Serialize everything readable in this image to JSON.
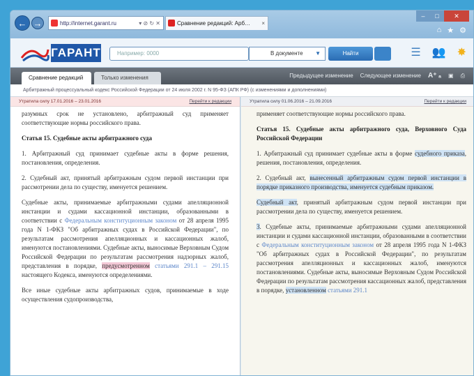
{
  "browser": {
    "address": "http://internet.garant.ru",
    "addr_controls": "▾ ⊘ ↻ ✕",
    "tab_title": "Сравнение редакций: Арб…",
    "tab_close": "×"
  },
  "app": {
    "logo_text": "ГАРАНТ",
    "search_placeholder": "Например: 0000",
    "scope_value": "В документе",
    "find_button": "Найти"
  },
  "doc_tabs": [
    "Сравнение редакций",
    "Только изменения"
  ],
  "toolbar": {
    "prev_change": "Предыдущее изменение",
    "next_change": "Следующее изменение",
    "font_size": "A⁺ ₐ"
  },
  "doc_title_line": "Арбитражный процессуальный кодекс Российской Федерации от 24 июля 2002 г. N 95-ФЗ (АПК РФ) (с изменениями и дополнениями)",
  "left": {
    "edition": "Утратила силу 17.01.2016 – 23.01.2016",
    "link": "Перейти к редакции",
    "intro": "разумных срок не установлено, арбитражный суд применяет соответствующие нормы российского права.",
    "heading": "Статья 15. Судебные акты арбитражного суда",
    "p1": "1. Арбитражный суд принимает судебные акты в форме решения, постановления, определения.",
    "p2": "2. Судебный акт, принятый арбитражным судом первой инстанции при рассмотрении дела по существу, именуется решением.",
    "p3_a": "Судебные акты, принимаемые арбитражными судами апелляционной инстанции и судами кассационной инстанции, образованными в соответствии с ",
    "p3_link": "Федеральным конституционным законом",
    "p3_b": " от 28 апреля 1995 года N 1-ФКЗ \"Об арбитражных судах в Российской Федерации\", по результатам рассмотрения апелляционных и кассационных жалоб, именуются постановлениями. Судебные акты, выносимые Верховным Судом Российской Федерации по результатам рассмотрения надзорных жалоб, представления в порядке, ",
    "p3_hl": "предусмотренном",
    "p3_link2": " статьями 291.1 – 291.15",
    "p3_c": " настоящего Кодекса, именуются определениями.",
    "p4": "Все иные судебные акты арбитражных судов, принимаемые в ходе осуществления судопроизводства,"
  },
  "right": {
    "edition": "Утратила силу 01.06.2016 – 21.09.2016",
    "link": "Перейти к редакции",
    "intro": "применяет соответствующие нормы российского права.",
    "heading": "Статья 15. Судебные акты арбитражного суда, Верховного Суда Российской Федерации",
    "p1_a": "1. Арбитражный суд принимает судебные акты в форме ",
    "p1_hl": "судебного приказа",
    "p1_b": ", решения, постановления, определения.",
    "p2_a": "2. Судебный акт, ",
    "p2_hl": "вынесенный арбитражным судом первой инстанции в порядке приказного производства, именуется судебным приказом.",
    "p3_hl": "Судебный акт",
    "p3_b": ", принятый арбитражным судом первой инстанции при рассмотрении дела по существу, именуется решением.",
    "p4_hl": "3",
    "p4_a": ". Судебные акты, принимаемые арбитражными судами апелляционной инстанции и судами кассационной инстанции, образованными в соответствии с ",
    "p4_link": "Федеральным конституционным законом",
    "p4_b": " от 28 апреля 1995 года N 1-ФКЗ \"Об арбитражных судах в Российской Федерации\", по результатам рассмотрения апелляционных и кассационных жалоб, именуются постановлениями. Судебные акты, выносимые Верховным Судом Российской Федерации по результатам рассмотрения кассационных жалоб, представления в порядке, ",
    "p4_hl2": "установленном",
    "p4_link2": " статьями 291.1"
  }
}
